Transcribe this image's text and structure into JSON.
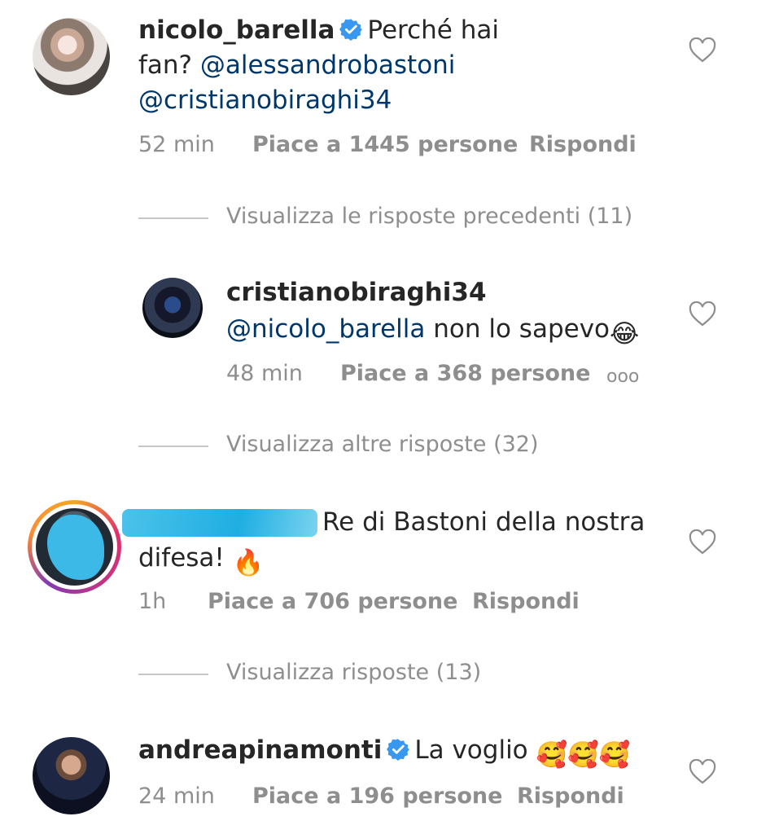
{
  "comments": [
    {
      "username": "nicolo_barella",
      "verified": true,
      "line1_text": "Perché hai",
      "line2_text": "fan?",
      "mention1": "@alessandrobastoni",
      "mention2": "@cristianobiraghi34",
      "time": "52 min",
      "likes": "Piace a 1445 persone",
      "reply": "Rispondi"
    },
    {
      "username": "cristianobiraghi34",
      "mention": "@nicolo_barella",
      "text": "non lo sapevo",
      "emoji": "😂",
      "time": "48 min",
      "likes": "Piace a 368 persone",
      "more": "ooo"
    },
    {
      "username_hidden": true,
      "text_line1": "Re di Bastoni della nostra",
      "text_line2": "difesa!",
      "emoji": "🔥",
      "time": "1h",
      "likes": "Piace a 706 persone",
      "reply": "Rispondi"
    },
    {
      "username": "andreapinamonti",
      "verified": true,
      "text": "La voglio",
      "emoji": "🥰🥰🥰",
      "time": "24 min",
      "likes": "Piace a 196 persone",
      "reply": "Rispondi"
    }
  ],
  "view_links": {
    "previous_replies": "Visualizza le risposte precedenti (11)",
    "more_replies": "Visualizza altre risposte (32)",
    "replies": "Visualizza risposte (13)"
  },
  "colors": {
    "mention": "#00376b",
    "meta": "#8e8e8e",
    "verified": "#3897f0"
  }
}
